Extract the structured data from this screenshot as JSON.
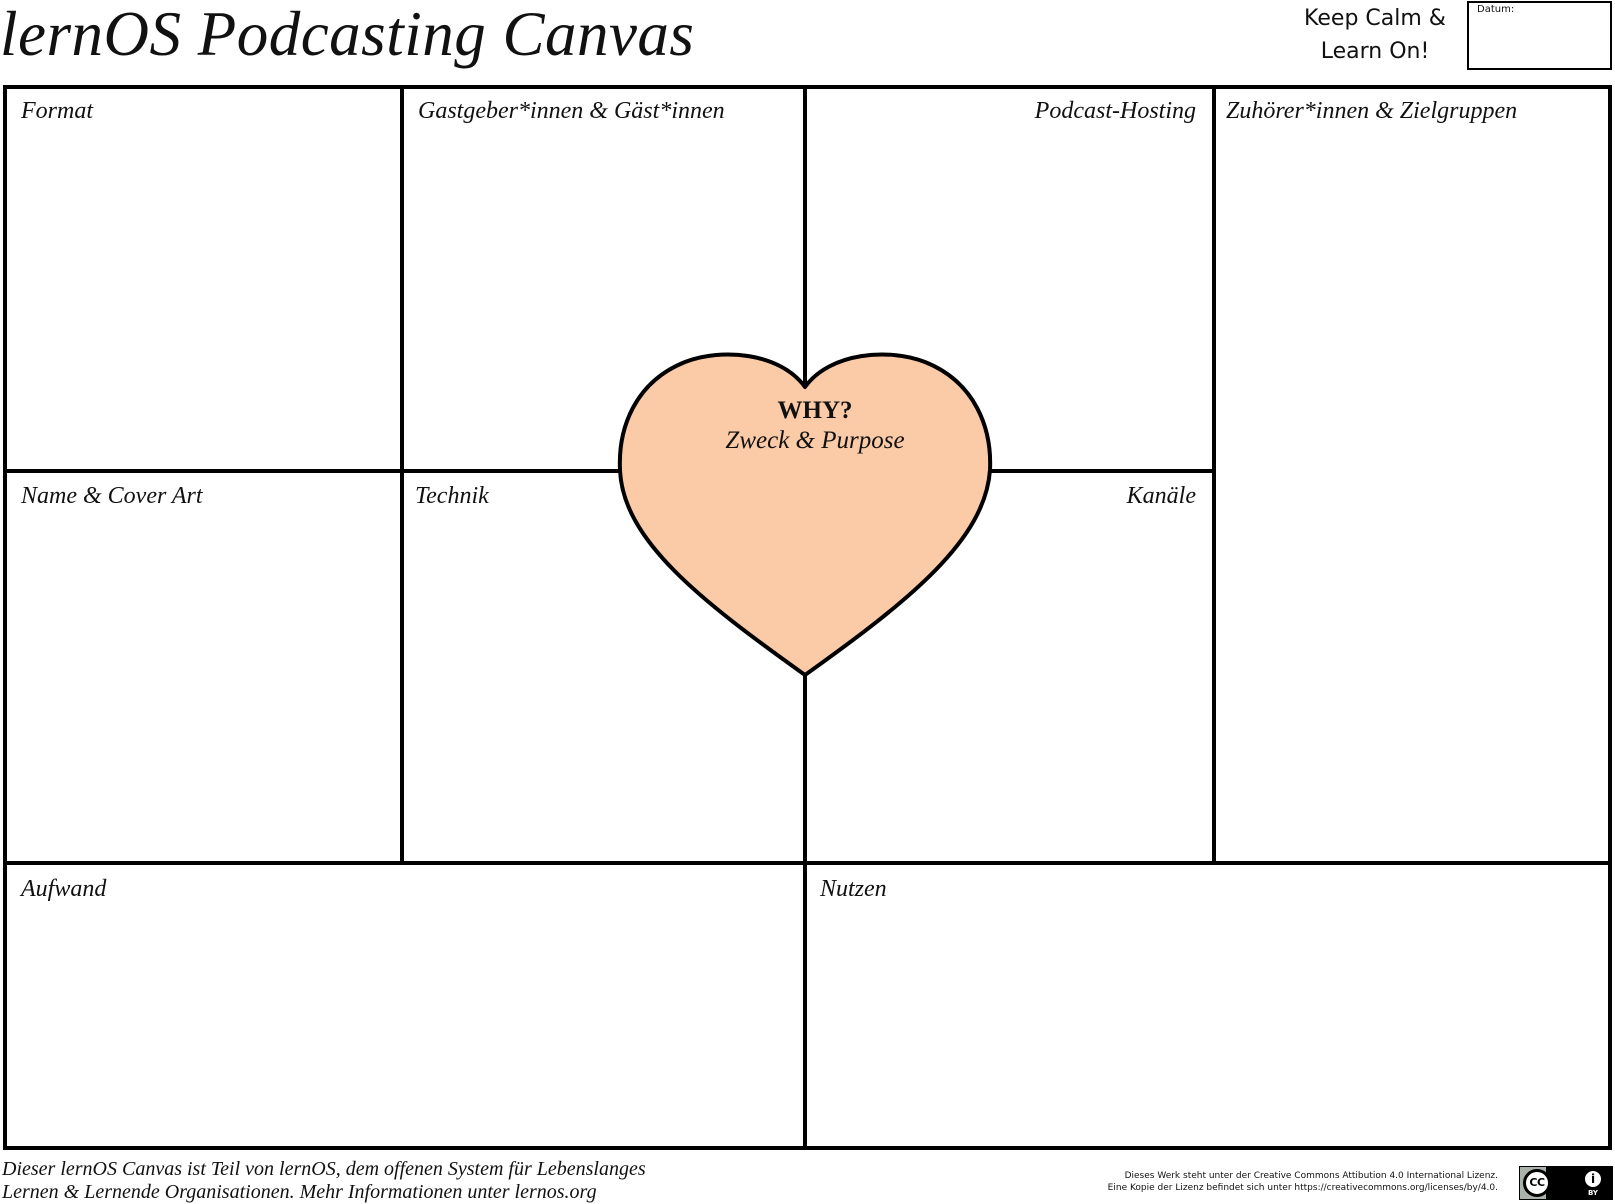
{
  "header": {
    "title": "lernOS Podcasting Canvas",
    "motto_line1": "Keep Calm &",
    "motto_line2": "Learn On!",
    "date_label": "Datum:"
  },
  "cells": {
    "format": "Format",
    "hosts_guests": "Gastgeber*innen & Gäst*innen",
    "hosting": "Podcast-Hosting",
    "audience": "Zuhörer*innen & Zielgruppen",
    "name_cover": "Name & Cover Art",
    "technik": "Technik",
    "kanaele": "Kanäle",
    "aufwand": "Aufwand",
    "nutzen": "Nutzen"
  },
  "center": {
    "title": "WHY?",
    "subtitle": "Zweck & Purpose"
  },
  "footer": {
    "left_line1": "Dieser lernOS Canvas ist Teil von lernOS, dem offenen System für Lebenslanges",
    "left_line2": "Lernen & Lernende Organisationen. Mehr Informationen unter lernos.org",
    "license_line1": "Dieses Werk steht unter der Creative Commons Attibution 4.0 International Lizenz.",
    "license_line2": "Eine Kopie der Lizenz befindet sich unter https://creativecommons.org/licenses/by/4.0.",
    "badge_cc": "CC",
    "badge_by_icon": "i",
    "badge_by": "BY"
  },
  "colors": {
    "heart_fill": "#fbcaa6",
    "line": "#000000"
  },
  "icons": {
    "cc_badge": "creative-commons-by-badge-icon",
    "heart": "heart-shape-icon"
  }
}
